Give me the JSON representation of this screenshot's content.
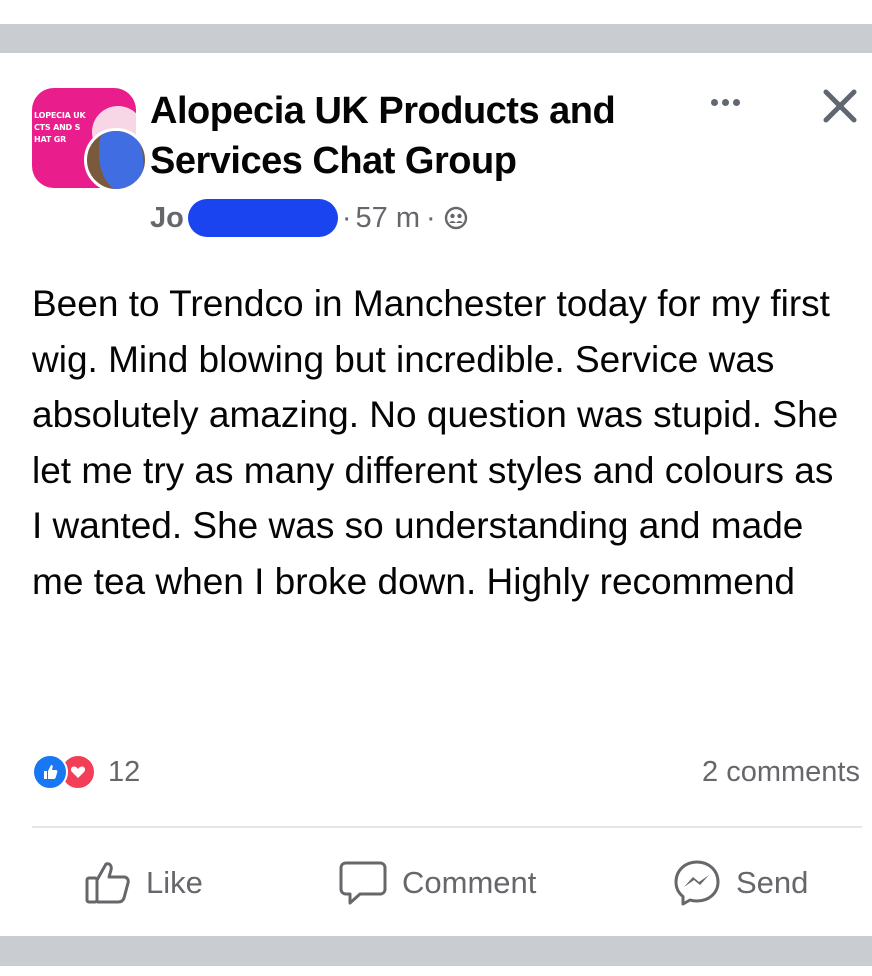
{
  "group": {
    "name": "Alopecia UK Products and Services Chat Group",
    "logo_text": "LOPECIA UK\nCTS AND S\nHAT GR"
  },
  "post": {
    "author_visible": "Jo",
    "time": "57 m",
    "separator": "·",
    "privacy_icon": "members-icon",
    "body": "Been to Trendco in Manchester today for my first wig. Mind blowing but incredible. Service was absolutely amazing. No question was stupid. She let me try as many different styles and colours as I wanted. She was so understanding and made me tea when I broke down. Highly recommend"
  },
  "reactions": {
    "types": [
      "like",
      "love"
    ],
    "count": "12"
  },
  "comments": {
    "label": "2 comments"
  },
  "actions": {
    "like": "Like",
    "comment": "Comment",
    "send": "Send"
  },
  "colors": {
    "accent": "#1877f2",
    "love": "#f33e58",
    "secondary_text": "#65676b",
    "band": "#c9ccd1",
    "group_logo": "#e91e8c",
    "redaction": "#1a44f0"
  }
}
